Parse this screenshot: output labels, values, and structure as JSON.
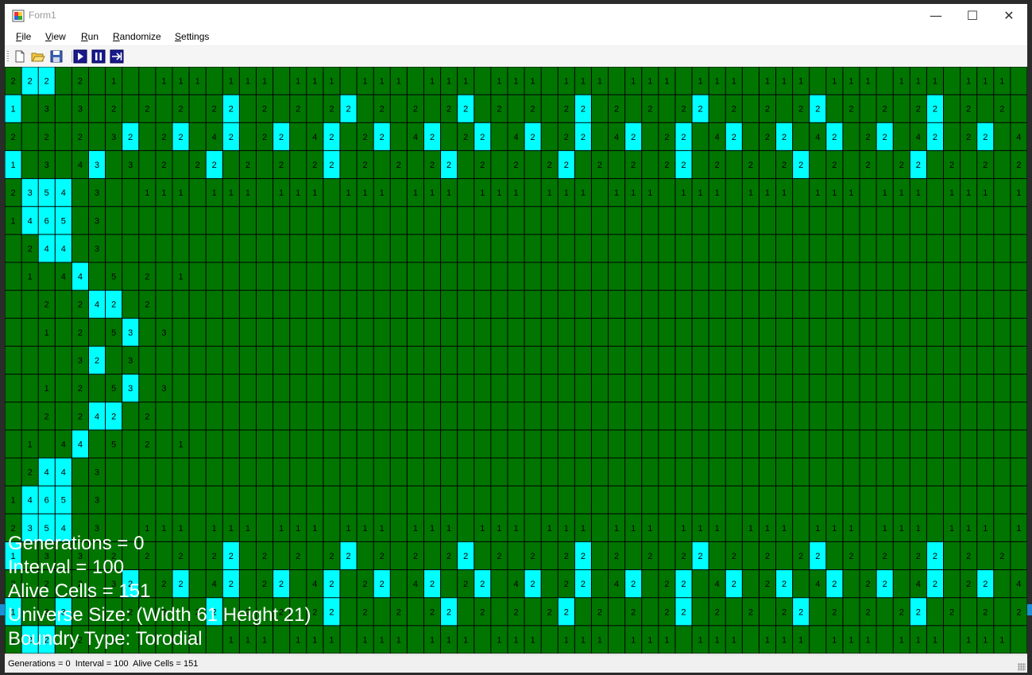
{
  "window": {
    "title": "Form1"
  },
  "title_buttons": {
    "minimize": "—",
    "maximize": "☐",
    "close": "✕"
  },
  "menu": [
    {
      "key": "F",
      "rest": "ile"
    },
    {
      "key": "V",
      "rest": "iew"
    },
    {
      "key": "R",
      "rest": "un"
    },
    {
      "key": "R",
      "rest": "andomize"
    },
    {
      "key": "S",
      "rest": "ettings"
    }
  ],
  "toolbar": {
    "icons": [
      "new-file-icon",
      "open-folder-icon",
      "save-icon",
      "play-icon",
      "pause-icon",
      "next-generation-icon"
    ]
  },
  "grid": {
    "columns": 61,
    "rows": 21,
    "colors": {
      "dead": "#007600",
      "alive": "#00ffff",
      "gridline": "#000000",
      "text": "#000000"
    },
    "cells": [
      "2*2*2 2 1  111 111 111 111 111 111 111 111 111 111 111 111 111 111 111",
      "*1 3 3 2 2 2 2*2 2 2 2*2 2 2 2*2 2 2 2*2 2 2 2*2 2 2 2*2 2 2 2*2 2 2 2*2 2 2 2*2 2 2 2*2 2 2 2*2 2 2 2*2 2 2 2*2 2 2 2*2 2 2 2*2 2 2 2*2 2",
      "2 2 2 3*2 2*2 4*2 2*2 4*2 2*2 4*2 2*2 4*2 2*2 4*2 2*2 4*2 2*2 4*2 2*2 4*2 2*2 4*2 2*2 4*2 2*2 4*2 2*2 4*2 2*2 4*2 2*2 4*2 2*2 4*2",
      "*1 3 4*3 3 2 2*2 2 2 2*2 2 2 2*2 2 2 2*2 2 2 2*2 2 2 2*2 2 2 2*2 2 2 2*2 2 2 2*2 2 2 2*2 2 2 2*2 2 2 2*2 2 2 2*2 2 2 2*2 2 2 2*2 2 2 2*2 2",
      "2*3*5*4 3  111 111 111 111 111 111 111 111 111 111 111 111 111 111 111",
      "1*4*6*5 3",
      " 2*4*4 3",
      " 1 4*4 5 2 1",
      "  2 2*4*2 2",
      "  1 2 5*3 3",
      "    3*2 3",
      "  1 2 5*3 3",
      "  2 2*4*2 2",
      " 1 4*4 5 2 1",
      " 2*4*4 3",
      "1*4*6*5 3",
      "2*3*5*4 3  111 111 111 111 111 111 111 111 111 111 111 111 111 111 111",
      "*1 3 3 2 2 2 2*2 2 2 2*2 2 2 2*2 2 2 2*2 2 2 2*2 2 2 2*2 2 2 2*2 2 2 2*2 2 2 2*2 2 2 2*2 2 2 2*2 2 2 2*2 2 2 2*2 2 2 2*2 2 2 2*2 2 2 2*2 2",
      "2 2 2 3*2 2*2 4*2 2*2 4*2 2*2 4*2 2*2 4*2 2*2 4*2 2*2 4*2 2*2 4*2 2*2 4*2 2*2 4*2 2*2 4*2 2*2 4*2 2*2 4*2 2*2 4*2 2*2 4*2 2*2 4*2",
      "*1 3*3 2 2 2 2*2 2 2 2*2 2 2 2*2 2 2 2*2 2 2 2*2 2 2 2*2 2 2 2*2 2 2 2*2 2 2 2*2 2 2 2*2 2 2 2*2 2 2 2*2 2 2 2*2 2 2 2*2 2 2 2*2 2 2 2*2 2",
      "2*2*2 2 1  111 111 111 111 111 111 111 111 111 111 111 111 111 111 111"
    ]
  },
  "overlay": {
    "generations": "Generations = 0",
    "interval": "Interval = 100",
    "alive_cells": "Alive Cells = 151",
    "universe_size": "Universe Size: (Width 61 Height 21)",
    "boundary_type": "Boundry Type: Torodial"
  },
  "status": {
    "text": "Generations = 0  Interval = 100  Alive Cells = 151"
  }
}
